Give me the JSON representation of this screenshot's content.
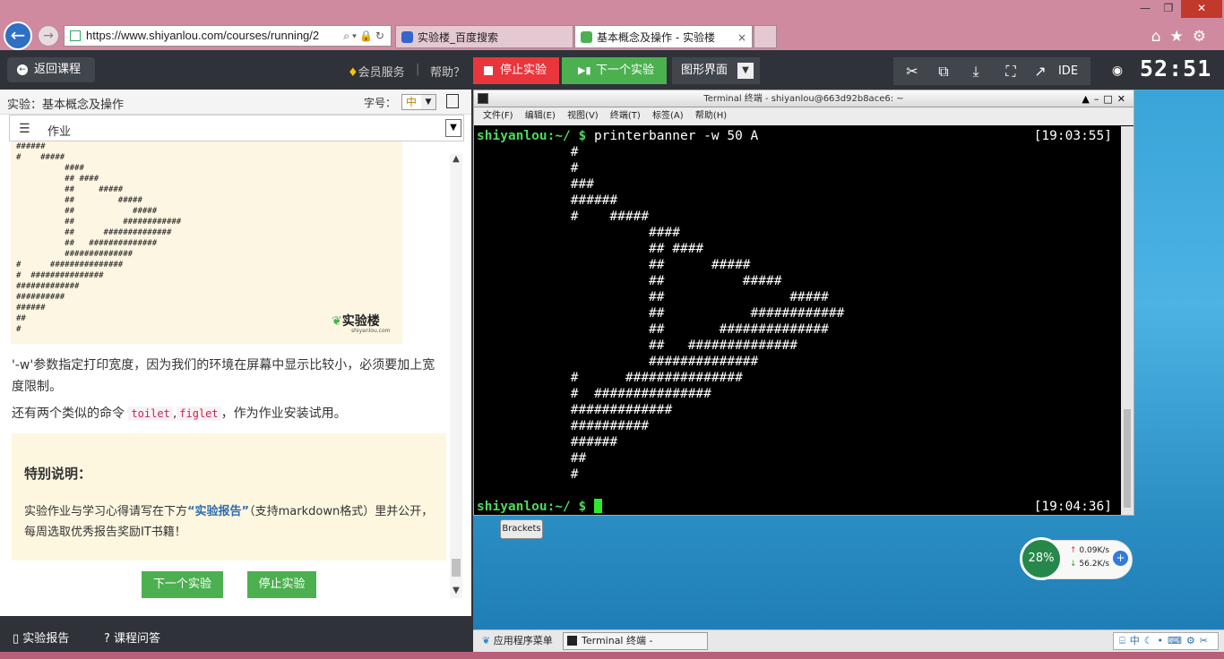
{
  "browser": {
    "url": "https://www.shiyanlou.com/courses/running/2",
    "tabs": [
      {
        "label": "实验楼_百度搜索"
      },
      {
        "label": "基本概念及操作 - 实验楼"
      }
    ],
    "tab_close": "×",
    "win_min": "—",
    "win_max": "❐",
    "win_close": "✕"
  },
  "site": {
    "back_label": "返回课程",
    "vip_label": "会员服务",
    "sep": "|",
    "help_label": "帮助？",
    "stop_label": "停止实验",
    "next_label": "下一个实验",
    "gfx_label": "图形界面",
    "ide_label": "IDE",
    "timer": "52:51"
  },
  "left": {
    "title": "实验：基本概念及操作",
    "fontsize_label": "字号：",
    "fontsize_value": "中",
    "section": "作业",
    "ascii_banner": "######\n#    #####\n          ####\n          ## ####\n          ##     #####\n          ##         #####\n          ##            #####\n          ##          ############\n          ##      ##############\n          ##   ##############\n          ##############\n#      ###############\n#  ###############\n#############\n##########\n######\n##\n#",
    "logo_text": "实验楼",
    "logo_sub": "shiyanlou.com",
    "para1": "'-w'参数指定打印宽度，因为我们的环境在屏幕中显示比较小，必须要加上宽度限制。",
    "para2_prefix": "还有两个类似的命令",
    "cmd1": "toilet",
    "comma": ",",
    "cmd2": "figlet",
    "para2_suffix": "，作为作业安装试用。",
    "note_title": "特别说明：",
    "note_text_1": "实验作业与学习心得请写在下方",
    "note_highlight": "“实验报告”",
    "note_text_2": "（支持markdown格式）里并公开，每周选取优秀报告奖励IT书籍！",
    "btn_next": "下一个实验",
    "btn_stop": "停止实验",
    "footer_report": "实验报告",
    "footer_qa": "课程问答"
  },
  "terminal": {
    "title": "Terminal 终端 - shiyanlou@663d92b8ace6: ~",
    "menu": [
      "文件(F)",
      "编辑(E)",
      "视图(V)",
      "终端(T)",
      "标签(A)",
      "帮助(H)"
    ],
    "prompt": "shiyanlou:~/ $",
    "command": " printerbanner -w 50 A",
    "time1": "[19:03:55]",
    "output": "            #\n            #\n            ###\n            ######\n            #    #####\n                      ####\n                      ## ####\n                      ##      #####\n                      ##          #####\n                      ##                #####\n                      ##           ############\n                      ##       ##############\n                      ##   ##############\n                      ##############\n            #      ###############\n            #  ###############\n            #############\n            ##########\n            ######\n            ##\n            #",
    "time2": "[19:04:36]"
  },
  "desktop": {
    "tooltip": "Brackets",
    "cpu": "28%",
    "net_up": "0.09K/s",
    "net_down": "56.2K/s",
    "panel_apps": "应用程序菜单",
    "panel_task": "Terminal 终端 - shiyanlou@…",
    "tray_ime": "中"
  }
}
